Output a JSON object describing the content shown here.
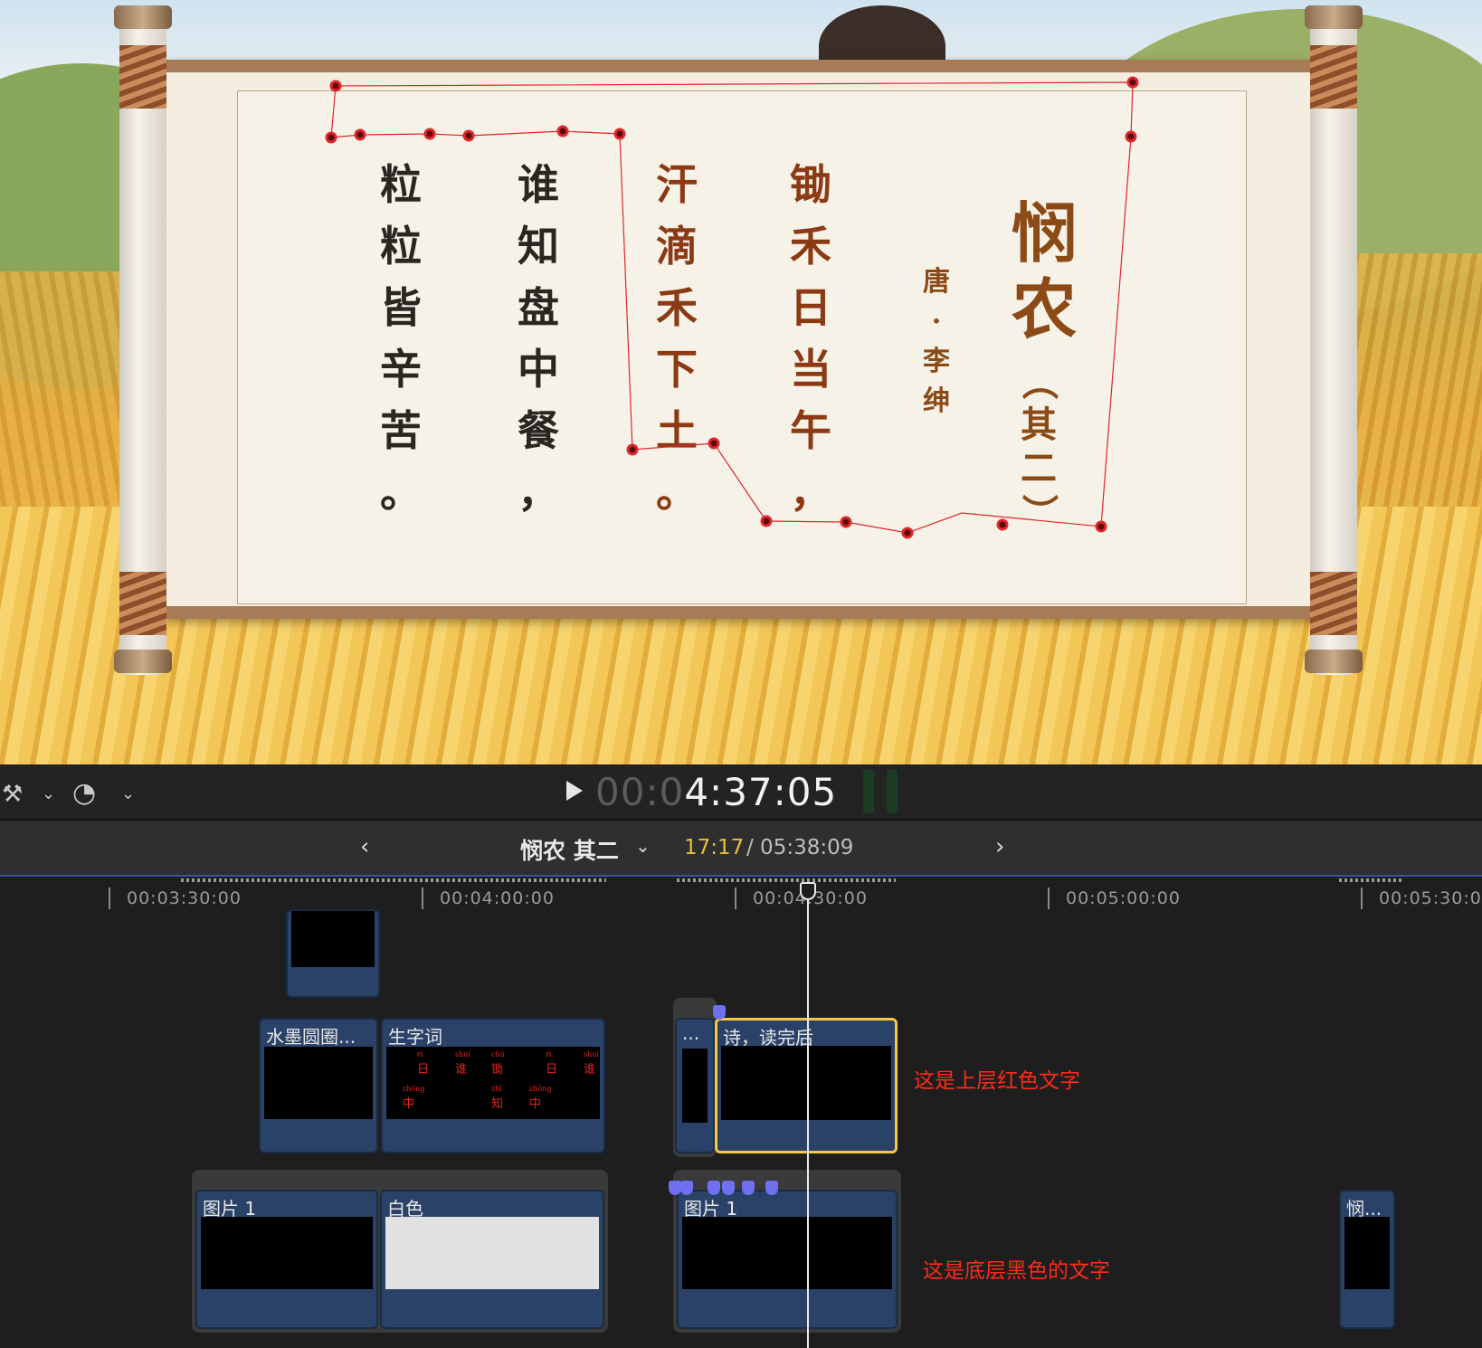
{
  "viewer": {
    "title_chars": [
      "悯",
      "农"
    ],
    "subtitle_chars": [
      "（",
      "其",
      "二",
      "）"
    ],
    "author_chars": [
      "唐",
      "·",
      "李",
      "绅"
    ],
    "poem_columns": [
      {
        "chars": [
          "锄",
          "禾",
          "日",
          "当",
          "午",
          "，"
        ],
        "style": "red"
      },
      {
        "chars": [
          "汗",
          "滴",
          "禾",
          "下",
          "土",
          "。"
        ],
        "style": "black"
      },
      {
        "chars": [
          "谁",
          "知",
          "盘",
          "中",
          "餐",
          "，"
        ],
        "style": "black"
      },
      {
        "chars": [
          "粒",
          "粒",
          "皆",
          "辛",
          "苦",
          "。"
        ],
        "style": "black"
      }
    ],
    "mask_color": "#e0262a"
  },
  "transport": {
    "timecode_dim": "00:0",
    "timecode_main": "4:37:05",
    "magic_icon": "magic-wand-icon",
    "speed_icon": "retime-icon"
  },
  "timeline_header": {
    "project_name": "悯农 其二",
    "current": "17:17",
    "total": "/ 05:38:09",
    "accent": "#e5c13b"
  },
  "ruler": {
    "labels": [
      "00:03:30:00",
      "00:04:00:00",
      "00:04:30:00",
      "00:05:00:00",
      "00:05:30:0"
    ]
  },
  "clips": {
    "ink_circle": "水墨圆圈...",
    "new_words": "生字词",
    "small_ellipsis": "...",
    "poem_read": "诗，读完后",
    "image1_a": "图片 1",
    "white": "白色",
    "image1_b": "图片 1",
    "min_title": "悯..."
  },
  "new_words_thumb": {
    "top_row": [
      {
        "pinyin": "rì",
        "char": "日"
      },
      {
        "pinyin": "shuí",
        "char": "谁"
      },
      {
        "pinyin": "chú",
        "char": "锄"
      },
      {
        "pinyin": "rì",
        "char": "日"
      },
      {
        "pinyin": "shuí",
        "char": "谁"
      }
    ],
    "bottom_row": [
      {
        "pinyin": "zhōng",
        "char": "中"
      },
      {
        "pinyin": "zhī",
        "char": "知"
      },
      {
        "pinyin": "zhōng",
        "char": "中"
      }
    ]
  },
  "annotations": {
    "upper": "这是上层红色文字",
    "lower": "这是底层黑色的文字",
    "color": "#ff2a1a"
  }
}
